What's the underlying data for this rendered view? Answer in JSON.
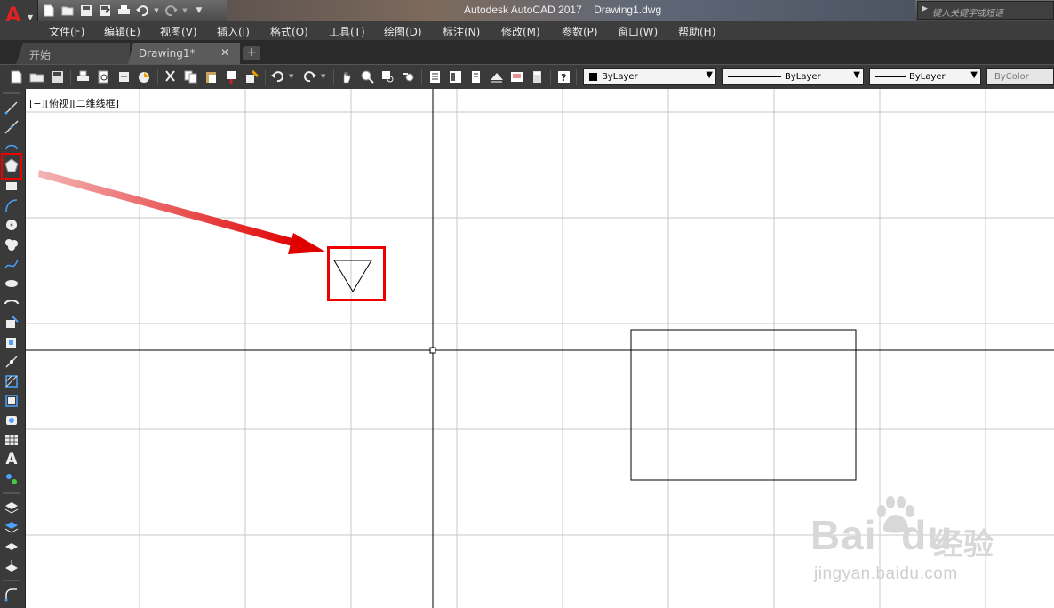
{
  "app": {
    "title": "Autodesk AutoCAD 2017    Drawing1.dwg",
    "logo_letter": "A",
    "search_placeholder": "键入关键字或短语"
  },
  "menu": [
    "文件(F)",
    "编辑(E)",
    "视图(V)",
    "插入(I)",
    "格式(O)",
    "工具(T)",
    "绘图(D)",
    "标注(N)",
    "修改(M)",
    "参数(P)",
    "窗口(W)",
    "帮助(H)"
  ],
  "tabs": [
    {
      "label": "开始",
      "active": false
    },
    {
      "label": "Drawing1*",
      "active": true,
      "close": "✕"
    }
  ],
  "tab_add": "+",
  "properties": {
    "color": "ByLayer",
    "linetype": "ByLayer",
    "lineweight": "ByLayer",
    "plotstyle": "ByColor"
  },
  "viewport_label": "[−][俯视][二维线框]",
  "watermark": {
    "logo": "Bai  du",
    "zh": "经验",
    "url": "jingyan.baidu.com"
  },
  "colors": {
    "highlight": "#e00000",
    "accent": "#e22222"
  }
}
